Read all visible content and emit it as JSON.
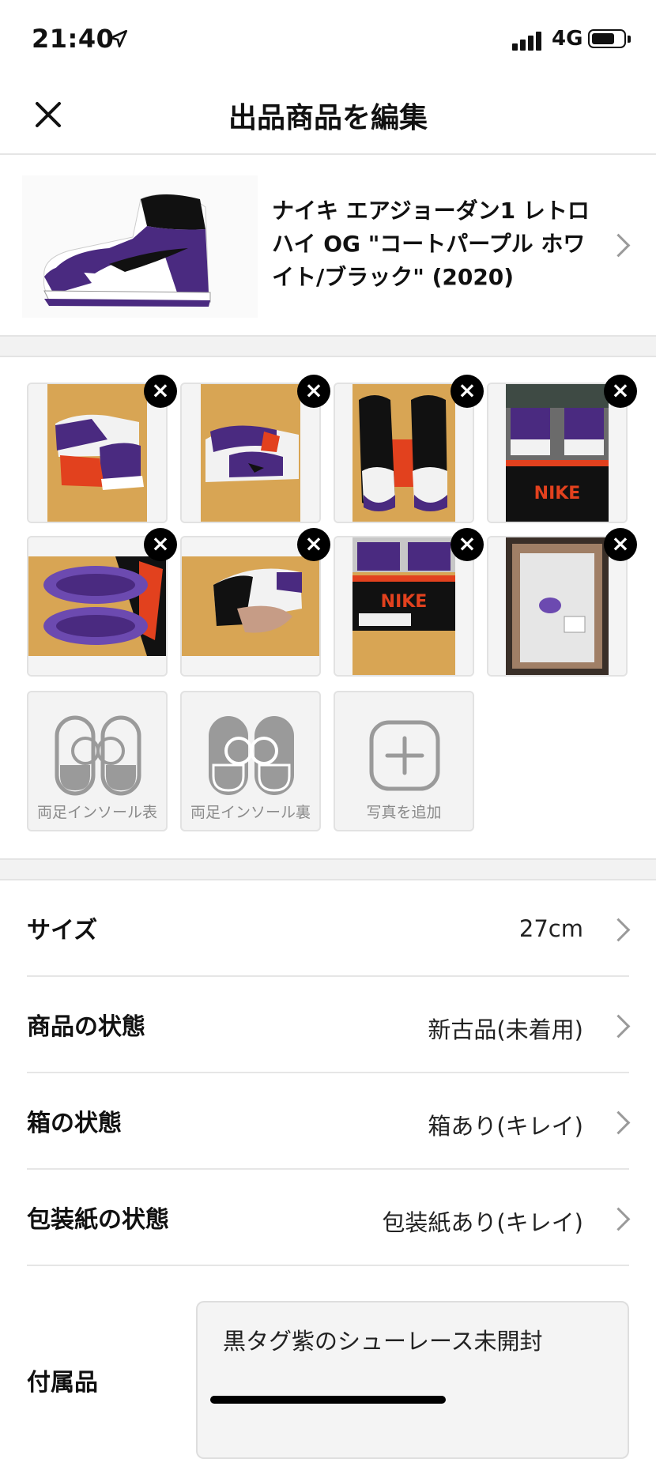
{
  "status_bar": {
    "time": "21:40",
    "network": "4G"
  },
  "header": {
    "title": "出品商品を編集"
  },
  "product": {
    "name": "ナイキ エアジョーダン1 レトロ ハイ OG \"コートパープル ホワイト/ブラック\" (2020)"
  },
  "photos": {
    "count": 8,
    "delete_symbol": "×"
  },
  "photo_slots": [
    {
      "label": "両足インソール表"
    },
    {
      "label": "両足インソール裏"
    },
    {
      "label": "写真を追加"
    }
  ],
  "details": [
    {
      "label": "サイズ",
      "value": "27cm"
    },
    {
      "label": "商品の状態",
      "value": "新古品(未着用)"
    },
    {
      "label": "箱の状態",
      "value": "箱あり(キレイ)"
    },
    {
      "label": "包装紙の状態",
      "value": "包装紙あり(キレイ)"
    }
  ],
  "accessories": {
    "label": "付属品",
    "value": "黒タグ紫のシューレース未開封"
  },
  "colors": {
    "accent_purple": "#4a2a80",
    "box_orange": "#e2411e",
    "background": "#ffffff"
  }
}
